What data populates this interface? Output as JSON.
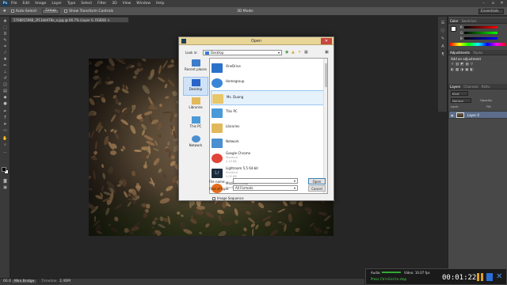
{
  "app": {
    "logo": "Ps",
    "menu": [
      "File",
      "Edit",
      "Image",
      "Layer",
      "Type",
      "Select",
      "Filter",
      "3D",
      "View",
      "Window",
      "Help"
    ]
  },
  "options_bar": {
    "auto_select": "Auto-Select:",
    "group": "Group",
    "show_transform": "Show Transform Controls",
    "mode_3d": "3D Mode:",
    "workspace": "Essentials"
  },
  "document_tab": "5768915968_2f13dd478e_o.jpg @ 66.7% (Layer 0, RGB/8) ×",
  "status": {
    "zoom": "66.67%",
    "doc": "Doc: 3.46M/2.46M",
    "bottom_tabs": [
      "Mini Bridge",
      "Timeline"
    ]
  },
  "right_panel": {
    "color_tabs": [
      "Color",
      "Swatches"
    ],
    "sliders": [
      "R",
      "G",
      "B"
    ],
    "adjust_tabs": [
      "Adjustments",
      "Styles"
    ],
    "adjust_title": "Add an adjustment",
    "layers_tabs": [
      "Layers",
      "Channels",
      "Paths"
    ],
    "kind": "Kind",
    "normal": "Normal",
    "opacity": "Opacity:",
    "lock": "Lock:",
    "fill": "Fill:",
    "layer_name": "Layer 0"
  },
  "dialog": {
    "title": "Open",
    "close": "✕",
    "look_in_label": "Look in:",
    "look_in_value": "Desktop",
    "places": [
      "Recent places",
      "Desktop",
      "Libraries",
      "This PC",
      "Network"
    ],
    "items": [
      {
        "name": "OneDrive",
        "sub": "",
        "icon": "onedrive-icon",
        "color": "#2a72c9"
      },
      {
        "name": "Homegroup",
        "sub": "",
        "icon": "homegroup-icon",
        "color": "#3a85d8"
      },
      {
        "name": "Ms. Duong",
        "sub": "",
        "icon": "user-folder-icon",
        "color": "#e8c66a"
      },
      {
        "name": "This PC",
        "sub": "",
        "icon": "pc-icon",
        "color": "#4a9ad8"
      },
      {
        "name": "Libraries",
        "sub": "",
        "icon": "libraries-icon",
        "color": "#e2b95a"
      },
      {
        "name": "Network",
        "sub": "",
        "icon": "network-icon",
        "color": "#4b8fd0"
      },
      {
        "name": "Google Chrome",
        "sub": "Shortcut\n2.15 KB",
        "icon": "chrome-icon",
        "color": "#e0453a"
      },
      {
        "name": "Lightroom 5.5 64-bit",
        "sub": "Shortcut\n2.02 KB",
        "icon": "lightroom-icon",
        "color": "#1c2b3a"
      },
      {
        "name": "Mozilla Firefox",
        "sub": "Shortcut",
        "icon": "firefox-icon",
        "color": "#e36d1d"
      }
    ],
    "file_name_label": "File name:",
    "file_name_value": "",
    "files_type_label": "Files of type:",
    "files_type_value": "All Formats",
    "open_button": "Open",
    "cancel_button": "Cancel",
    "image_sequence": "Image Sequence"
  },
  "recorder": {
    "audio": "Audio:",
    "video": "Video: 10.07 fps",
    "hint": "Press Ctrl+End to stop",
    "time": "00:01:22"
  }
}
